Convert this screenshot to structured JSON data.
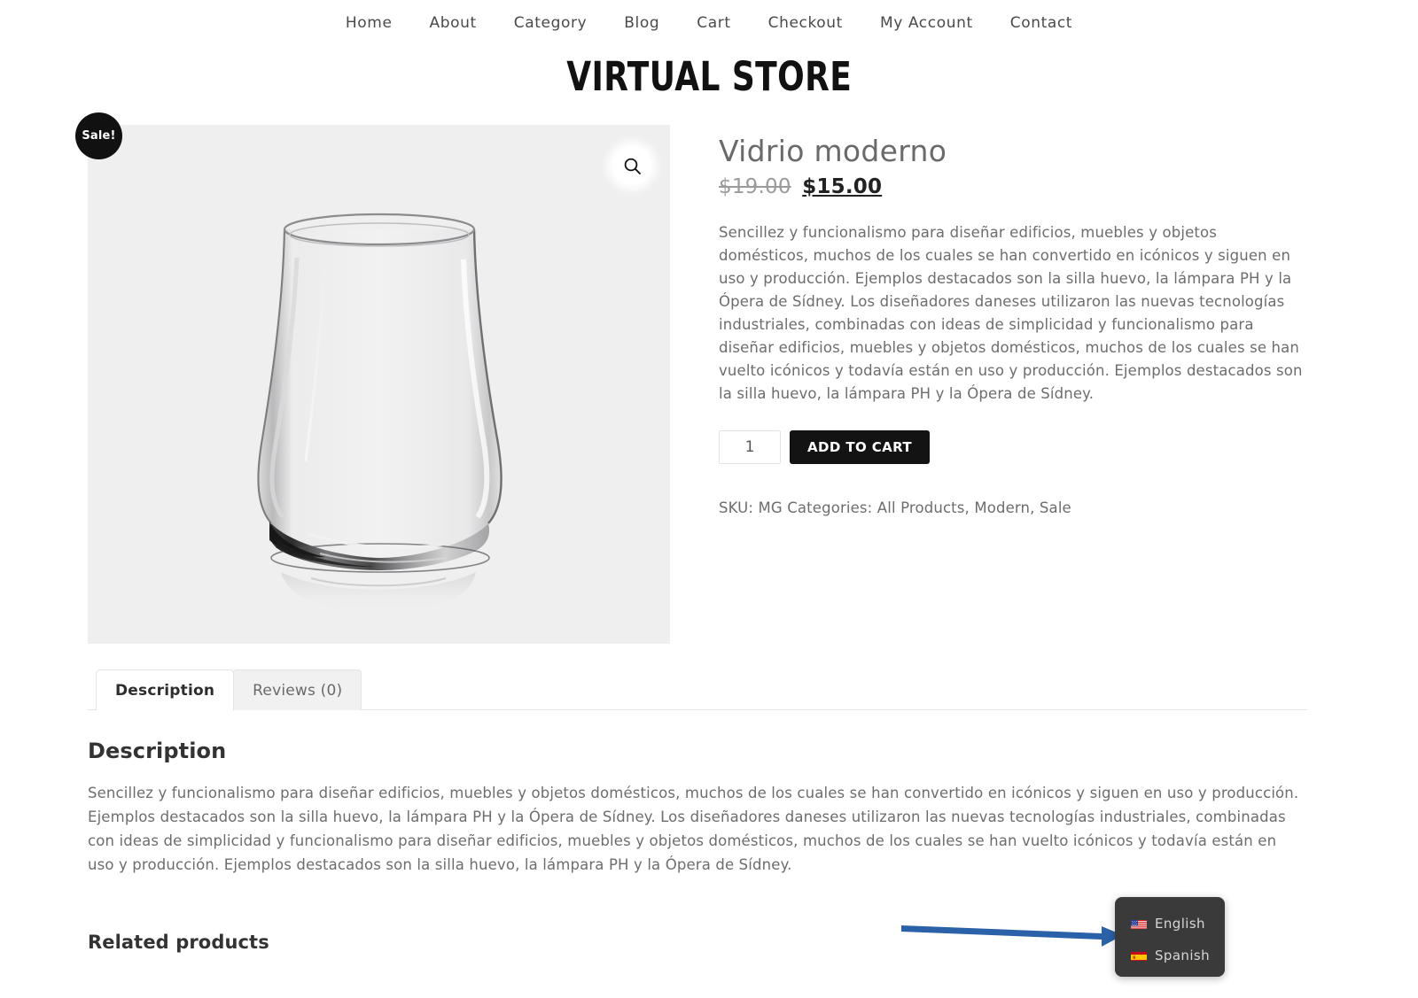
{
  "nav": {
    "items": [
      {
        "label": "Home"
      },
      {
        "label": "About"
      },
      {
        "label": "Category"
      },
      {
        "label": "Blog"
      },
      {
        "label": "Cart"
      },
      {
        "label": "Checkout"
      },
      {
        "label": "My Account"
      },
      {
        "label": "Contact"
      }
    ]
  },
  "site": {
    "logo_text": "VIRTUAL STORE"
  },
  "gallery": {
    "sale_badge": "Sale!",
    "zoom_icon": "search-icon",
    "image_alt": "Vidrio moderno glass tumbler",
    "background_color": "#efeff0"
  },
  "product": {
    "title": "Vidrio moderno",
    "price_old": "$19.00",
    "price_new": "$15.00",
    "short_description": "Sencillez y funcionalismo para diseñar edificios, muebles y objetos domésticos, muchos de los cuales se han convertido en icónicos y siguen en uso y producción. Ejemplos destacados son la silla huevo, la lámpara PH y la Ópera de Sídney. Los diseñadores daneses utilizaron las nuevas tecnologías industriales, combinadas con ideas de simplicidad y funcionalismo para diseñar edificios, muebles y objetos domésticos, muchos de los cuales se han vuelto icónicos y todavía están en uso y producción. Ejemplos destacados son la silla huevo, la lámpara PH y la Ópera de Sídney.",
    "quantity": "1",
    "add_to_cart_label": "ADD TO CART",
    "meta_line": "SKU: MG Categories: All Products, Modern, Sale",
    "sku_label": "SKU:",
    "sku_value": "MG",
    "categories_label": "Categories:",
    "categories_value": "All Products, Modern, Sale"
  },
  "tabs": [
    {
      "label": "Description",
      "active": true
    },
    {
      "label": "Reviews (0)",
      "active": false
    }
  ],
  "description_panel": {
    "heading": "Description",
    "body": "Sencillez y funcionalismo para diseñar edificios, muebles y objetos domésticos, muchos de los cuales se han convertido en icónicos y siguen en uso y producción. Ejemplos destacados son la silla huevo, la lámpara PH y la Ópera de Sídney. Los diseñadores daneses utilizaron las nuevas tecnologías industriales, combinadas con ideas de simplicidad y funcionalismo para diseñar edificios, muebles y objetos domésticos, muchos de los cuales se han vuelto icónicos y todavía están en uso y producción. Ejemplos destacados son la silla huevo, la lámpara PH y la Ópera de Sídney."
  },
  "related": {
    "heading": "Related products"
  },
  "language_switcher": {
    "panel_color": "#3a3a3a",
    "items": [
      {
        "label": "English",
        "flag": "flag-us-icon"
      },
      {
        "label": "Spanish",
        "flag": "flag-es-icon"
      }
    ]
  },
  "annotation": {
    "arrow_color": "#2b61a8",
    "arrow_direction": "right"
  }
}
